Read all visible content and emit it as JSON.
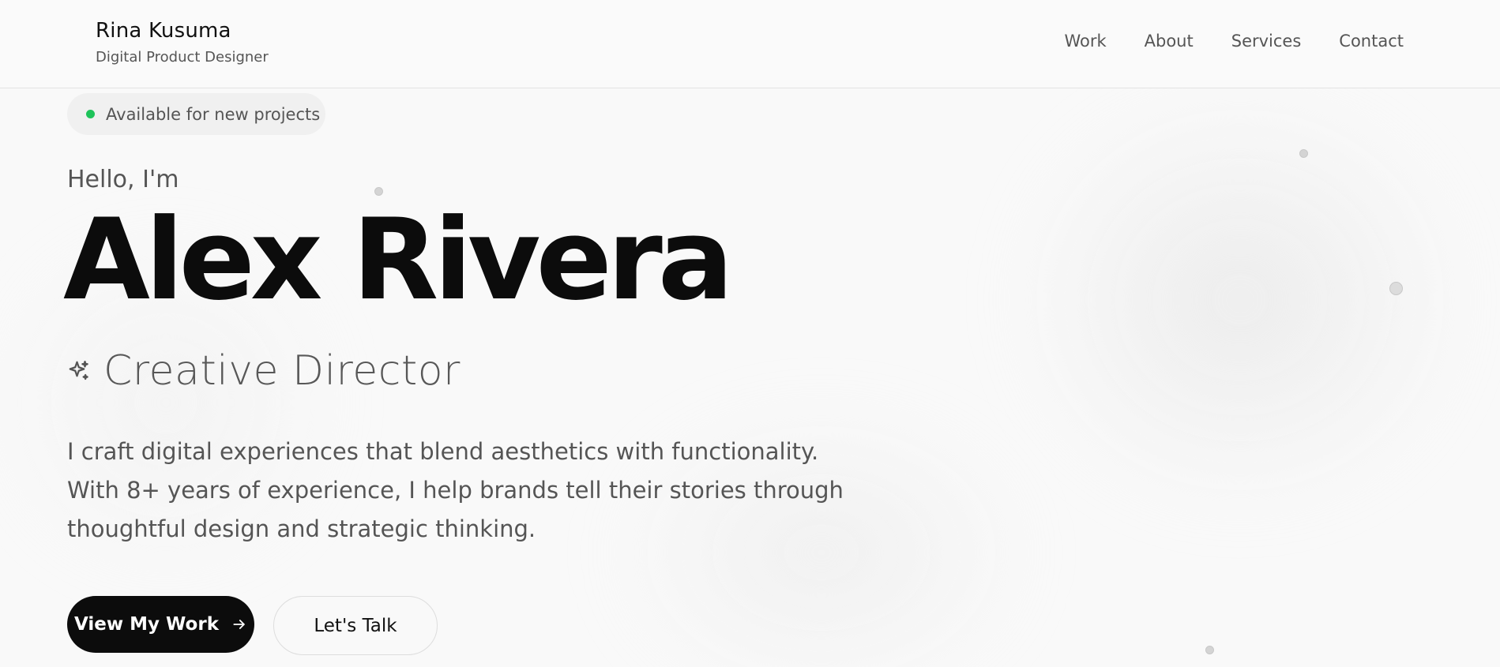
{
  "header": {
    "brand_name": "Rina Kusuma",
    "brand_subtitle": "Digital Product Designer",
    "nav": [
      {
        "label": "Work"
      },
      {
        "label": "About"
      },
      {
        "label": "Services"
      },
      {
        "label": "Contact"
      }
    ]
  },
  "hero": {
    "availability": "Available for new projects",
    "availability_color": "#1ec35a",
    "greeting": "Hello, I'm",
    "name": "Alex Rivera",
    "role_icon": "sparkle-icon",
    "role": "Creative Director",
    "bio": "I craft digital experiences that blend aesthetics with functionality. With 8+ years of experience, I help brands tell their stories through thoughtful design and strategic thinking.",
    "primary_button": "View My Work",
    "primary_button_icon": "arrow-right-icon",
    "secondary_button": "Let's Talk"
  }
}
